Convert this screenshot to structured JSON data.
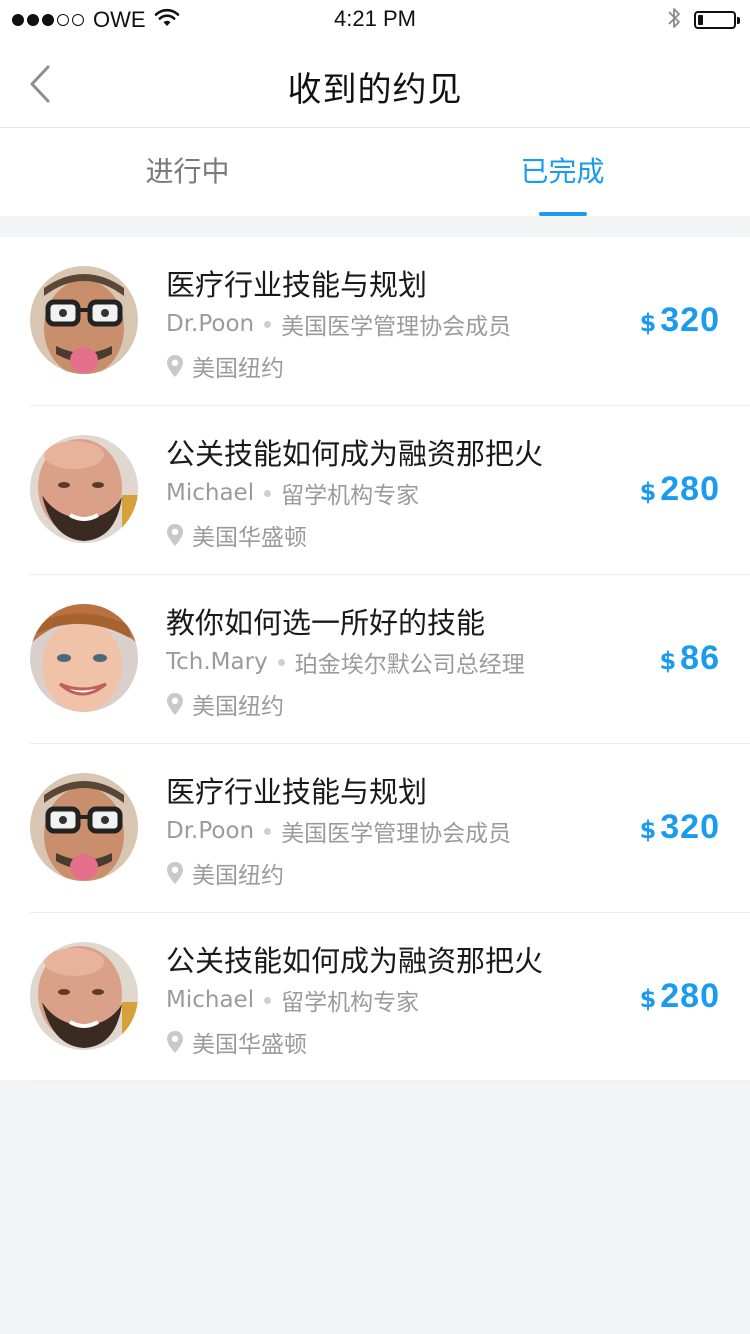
{
  "status_bar": {
    "carrier": "OWE",
    "time": "4:21 PM",
    "signal_bars": 3,
    "signal_total": 5,
    "battery_level": 0.15
  },
  "nav": {
    "title": "收到的约见",
    "back_icon": "chevron-left-icon"
  },
  "tabs": [
    {
      "label": "进行中",
      "active": false
    },
    {
      "label": "已完成",
      "active": true
    }
  ],
  "colors": {
    "accent": "#1a9bf0",
    "text_primary": "#1a1a1a",
    "text_secondary": "#9b9b9b",
    "tab_inactive": "#7a7a7a",
    "background": "#f3f4f6"
  },
  "currency_symbol": "$",
  "items": [
    {
      "title": "医疗行业技能与规划",
      "name": "Dr.Poon",
      "role": "美国医学管理协会成员",
      "location": "美国纽约",
      "price": "320",
      "avatar": "glasses-man-avatar"
    },
    {
      "title": "公关技能如何成为融资那把火",
      "name": "Michael",
      "role": "留学机构专家",
      "location": "美国华盛顿",
      "price": "280",
      "avatar": "bearded-man-avatar"
    },
    {
      "title": "教你如何选一所好的技能",
      "name": "Tch.Mary",
      "role": "珀金埃尔默公司总经理",
      "location": "美国纽约",
      "price": "86",
      "avatar": "smiling-woman-avatar"
    },
    {
      "title": "医疗行业技能与规划",
      "name": "Dr.Poon",
      "role": "美国医学管理协会成员",
      "location": "美国纽约",
      "price": "320",
      "avatar": "glasses-man-avatar"
    },
    {
      "title": "公关技能如何成为融资那把火",
      "name": "Michael",
      "role": "留学机构专家",
      "location": "美国华盛顿",
      "price": "280",
      "avatar": "bearded-man-avatar"
    }
  ]
}
